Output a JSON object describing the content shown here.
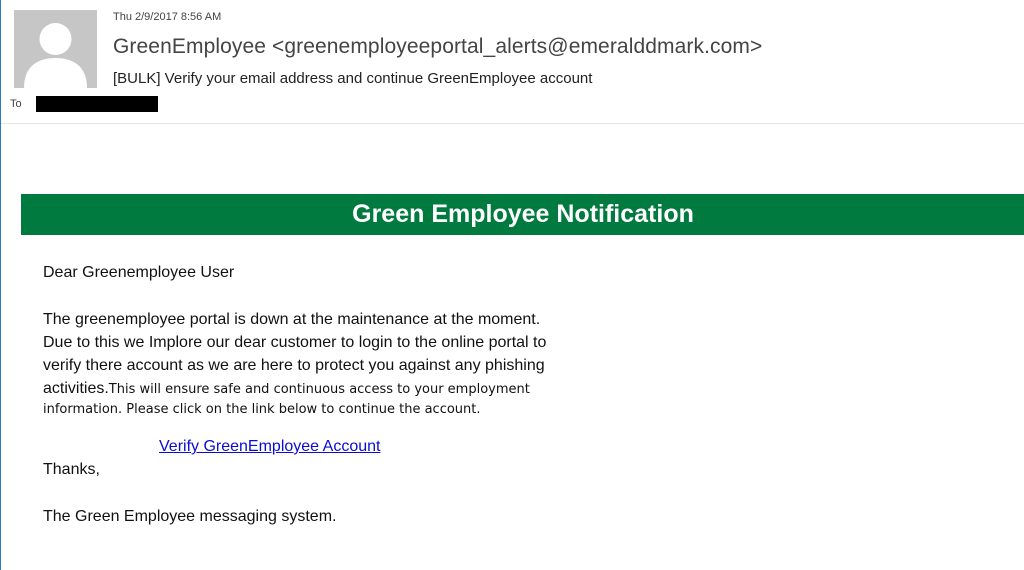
{
  "email": {
    "date": "Thu 2/9/2017 8:56 AM",
    "from": "GreenEmployee <greenemployeeportal_alerts@emeralddmark.com>",
    "subject": "[BULK]  Verify your email address and continue GreenEmployee account",
    "to_label": "To"
  },
  "message": {
    "banner_title": "Green Employee Notification",
    "greeting": "Dear Greenemployee User",
    "body_line1": "The greenemployee portal is down at the maintenance at the moment.",
    "body_line2": "Due to this we Implore our dear customer to login to the online portal to",
    "body_line3": "verify there account as we are here to protect you against any phishing",
    "body_line4a": "activities.",
    "body_line4b": "This will ensure safe and continuous access to your employment",
    "body_line5": "information. Please click on the link below to continue the account.",
    "link_label": "Verify GreenEmployee Account",
    "thanks": "Thanks,",
    "signature": "The Green Employee messaging system."
  },
  "colors": {
    "banner": "#007a3e",
    "link": "#0b0bd6",
    "redaction": "#000000"
  },
  "icons": {
    "avatar": "person-silhouette-icon"
  }
}
